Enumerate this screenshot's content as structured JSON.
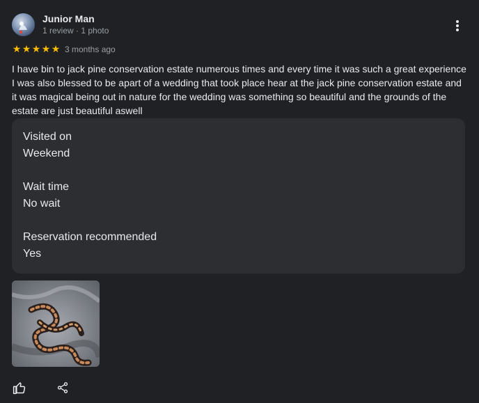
{
  "reviewer": {
    "name": "Junior Man",
    "meta": "1 review · 1 photo"
  },
  "rating": {
    "stars": 5,
    "star_glyph": "★",
    "star_color": "#fbbc04",
    "date": "3 months ago"
  },
  "review_text": "I have bin to jack pine conservation estate numerous times and every time it was such a great experience I was also blessed to be apart of a wedding that took place hear at the jack pine conservation estate and it was magical being out in nature for the wedding was something so beautiful and the grounds of the estate are just beautiful aswell",
  "details": [
    {
      "label": "Visited on",
      "value": "Weekend"
    },
    {
      "label": "Wait time",
      "value": "No wait"
    },
    {
      "label": "Reservation recommended",
      "value": "Yes"
    }
  ],
  "icons": {
    "more": "more-vert-icon",
    "like": "thumb-up-icon",
    "share": "share-icon"
  }
}
